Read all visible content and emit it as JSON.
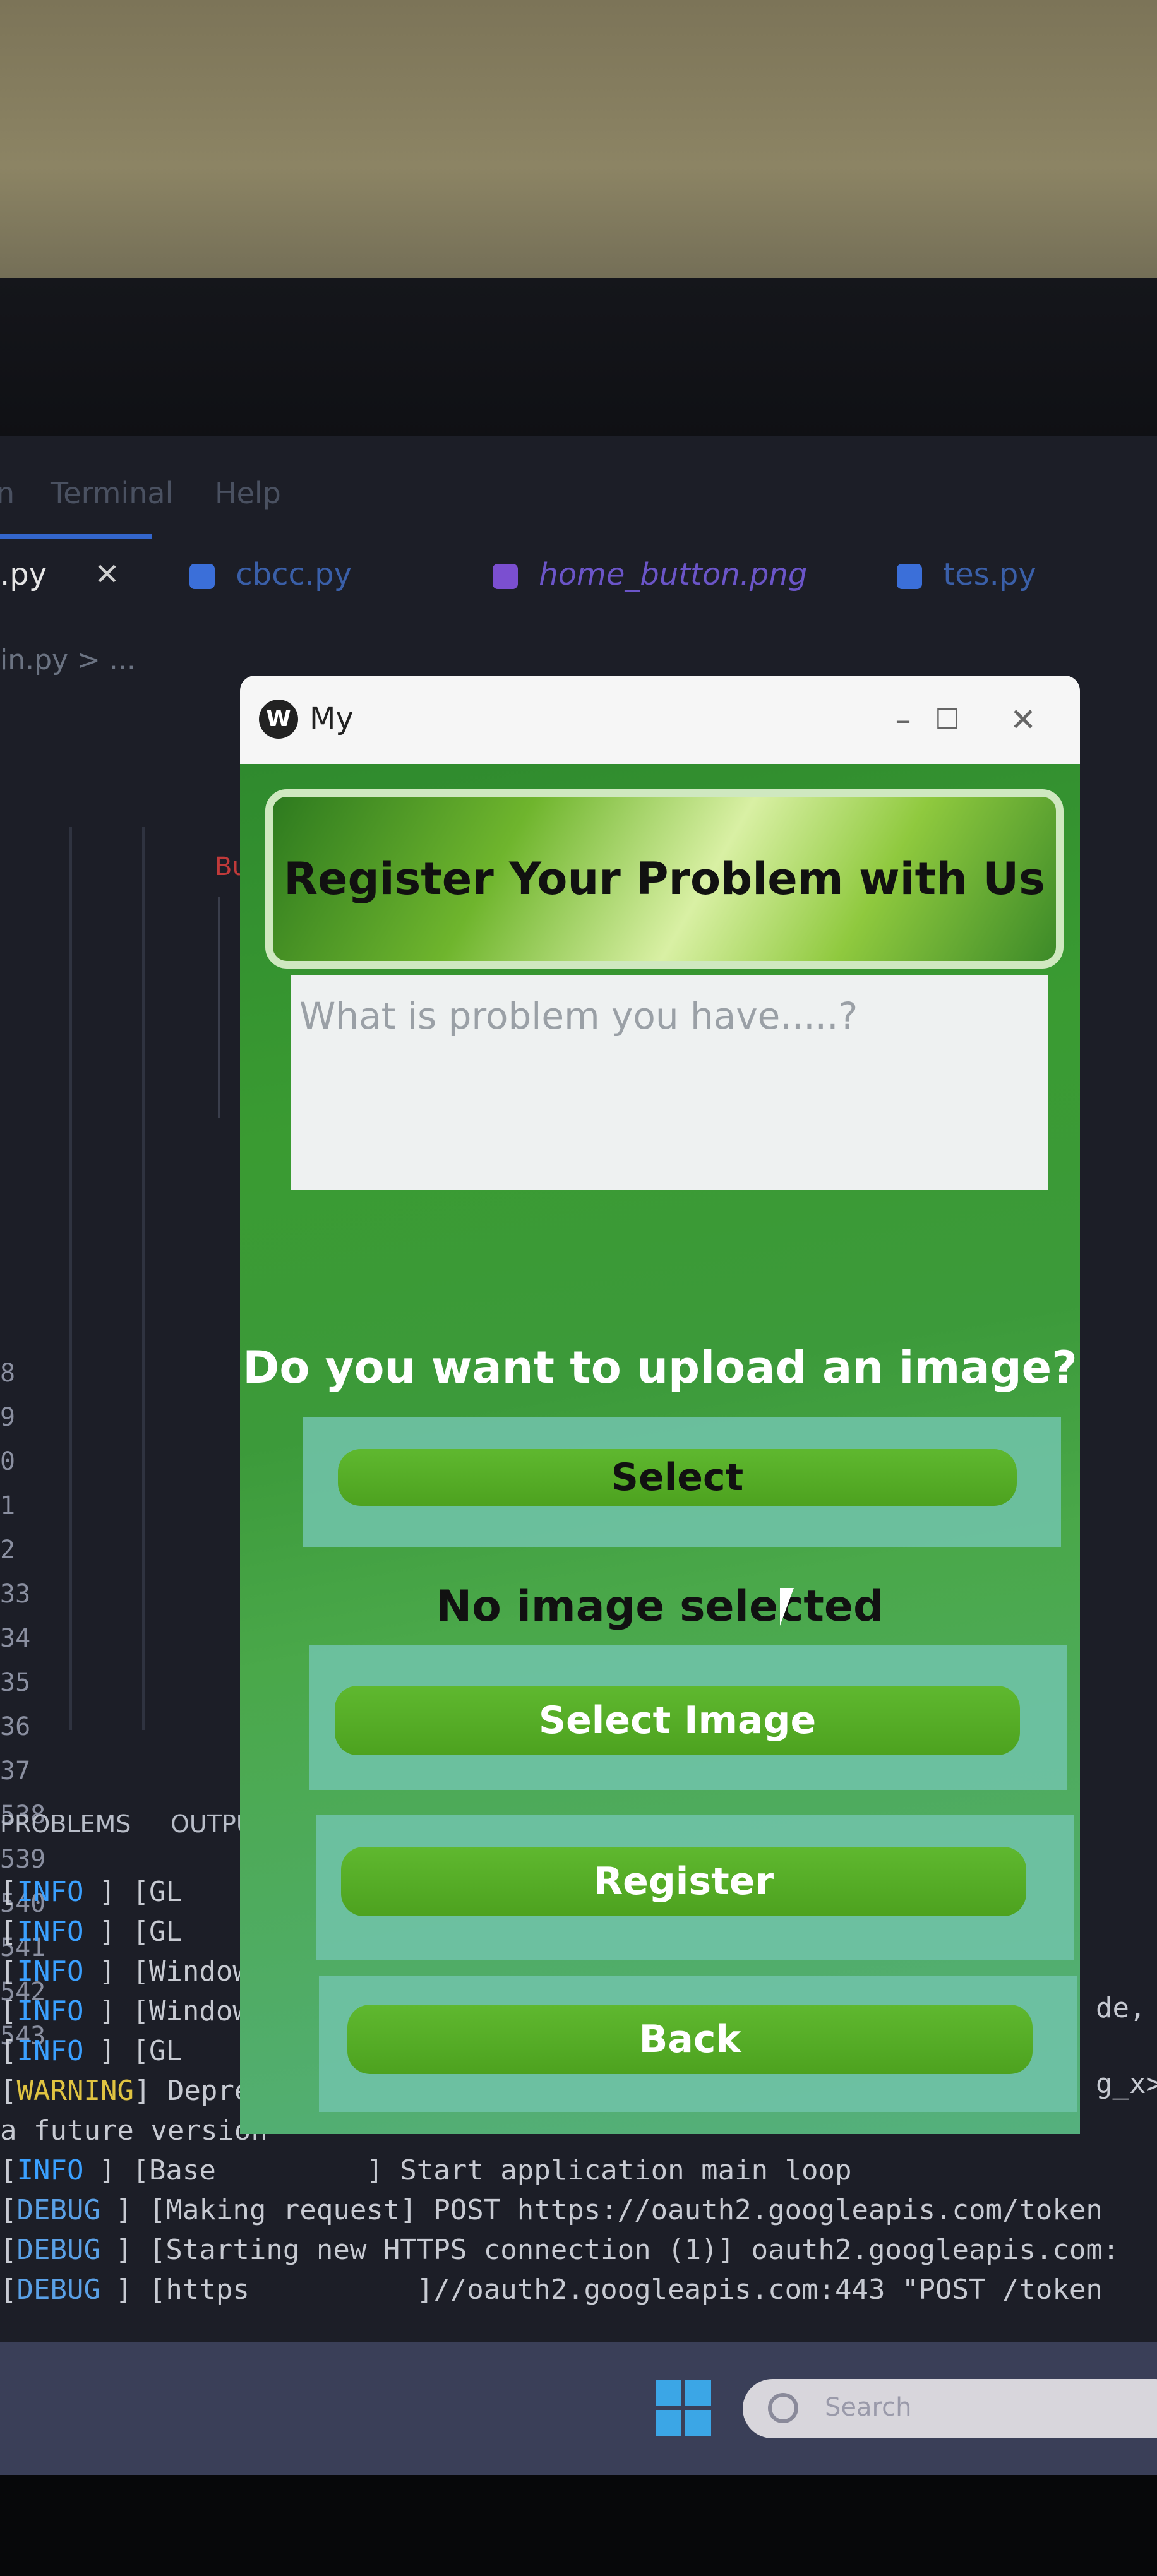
{
  "ide": {
    "menu": [
      "n",
      "Terminal",
      "Help"
    ],
    "tabs": [
      {
        "label": ".py",
        "color": "#e0e0e0"
      },
      {
        "label": "cbcc.py",
        "color": "#3b6fd9"
      },
      {
        "label": "home_button.png",
        "color": "#7b4fd0"
      },
      {
        "label": "tes.py",
        "color": "#3b6fd9"
      }
    ],
    "close_glyph": "✕",
    "breadcrumb": "in.py > ...",
    "line_numbers": [
      "",
      "",
      "",
      "",
      "",
      "",
      "8",
      "9",
      "0",
      "1",
      "2",
      "33",
      "34",
      "35",
      "36",
      "37",
      "538",
      "539",
      "540",
      "541",
      "542",
      "543"
    ],
    "bu_label_1": "Bu",
    "bu_label_2": "Bu",
    "panel_tabs": [
      "PROBLEMS",
      "OUTPUT"
    ],
    "log": [
      {
        "level": "INFO",
        "text": "] [GL"
      },
      {
        "level": "INFO",
        "text": "] [GL"
      },
      {
        "level": "INFO",
        "text": "] [Window"
      },
      {
        "level": "INFO",
        "text": "] [Window"
      },
      {
        "level": "INFO",
        "text": "] [GL"
      },
      {
        "level": "WARNING",
        "text": "] Deprecat"
      },
      {
        "level": "",
        "text": "a future version"
      },
      {
        "level": "INFO",
        "text": "] [Base         ] Start application main loop"
      },
      {
        "level": "DEBUG",
        "text": "] [Making request] POST https://oauth2.googleapis.com/token"
      },
      {
        "level": "DEBUG",
        "text": "] [Starting new HTTPS connection (1)] oauth2.googleapis.com:"
      },
      {
        "level": "DEBUG",
        "text": "] [https          ]//oauth2.googleapis.com:443 \"POST /token"
      }
    ],
    "log_right_fragments": [
      "de,",
      "g_x>"
    ],
    "taskbar_search_placeholder": "Search"
  },
  "app": {
    "window_title": "My",
    "controls": {
      "minimize": "–",
      "maximize": "☐",
      "close": "✕"
    },
    "header": "Register Your Problem with Us",
    "problem_placeholder": "What is problem you have.....?",
    "upload_question": "Do you want to upload an image?",
    "select_button": "Select",
    "image_status": "No image selected",
    "select_image_button": "Select Image",
    "register_button": "Register",
    "back_button": "Back",
    "colors": {
      "button_green": "#55ad27",
      "panel_teal": "#6fc2a6",
      "text_dark": "#111111"
    }
  }
}
